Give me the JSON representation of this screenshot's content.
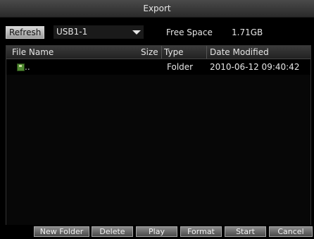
{
  "window": {
    "title": "Export"
  },
  "toolbar": {
    "refresh_label": "Refresh",
    "device_value": "USB1-1",
    "free_space_label": "Free Space",
    "free_space_value": "1.71GB"
  },
  "table": {
    "columns": [
      "File Name",
      "Size",
      "Type",
      "Date Modified"
    ],
    "rows": [
      {
        "icon": "folder-icon",
        "name": "..",
        "size": "",
        "type": "Folder",
        "date": "2010-06-12 09:40:42"
      }
    ]
  },
  "buttons": {
    "new_folder": "New Folder",
    "delete": "Delete",
    "play": "Play",
    "format": "Format",
    "start": "Start",
    "cancel": "Cancel"
  }
}
